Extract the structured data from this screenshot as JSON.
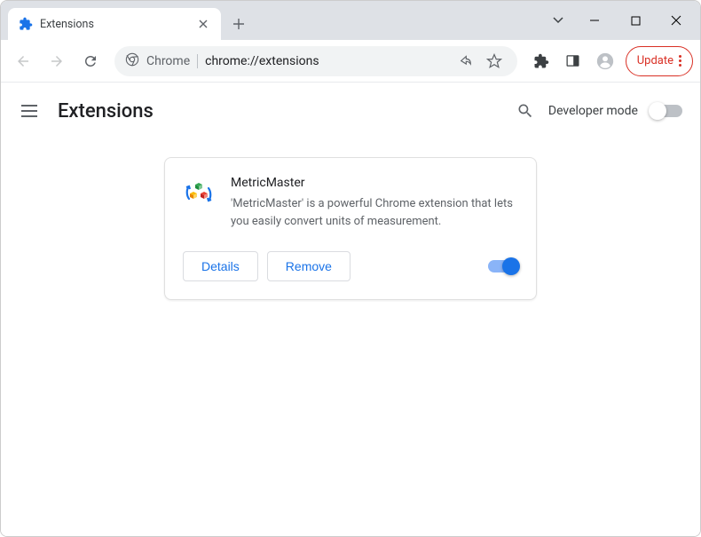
{
  "tab": {
    "title": "Extensions"
  },
  "omnibox": {
    "prefix": "Chrome",
    "url": "chrome://extensions"
  },
  "update_label": "Update",
  "page": {
    "title": "Extensions",
    "dev_mode_label": "Developer mode"
  },
  "extension": {
    "name": "MetricMaster",
    "description": "'MetricMaster' is a powerful Chrome extension that lets you easily convert units of measurement.",
    "details_label": "Details",
    "remove_label": "Remove",
    "enabled": true
  }
}
